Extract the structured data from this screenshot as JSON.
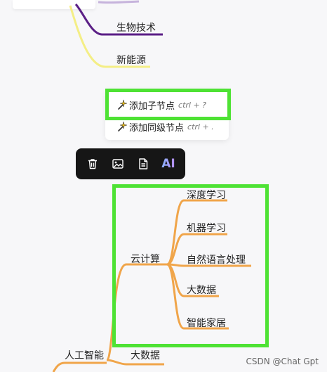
{
  "mindmap": {
    "upper_branch_nodes": [
      "生物技术",
      "新能源"
    ],
    "cloud_node": "云计算",
    "cloud_children": [
      "深度学习",
      "机器学习",
      "自然语言处理",
      "大数据",
      "智能家居"
    ],
    "root_node": "人工智能",
    "root_sibling": "大数据"
  },
  "context_menu": {
    "items": [
      {
        "label": "添加子节点",
        "shortcut": "ctrl + ?"
      },
      {
        "label": "添加同级节点",
        "shortcut": "ctrl + ."
      }
    ]
  },
  "node_toolbar": {
    "buttons": [
      "trash-icon",
      "image-icon",
      "document-icon",
      "ai-button"
    ],
    "ai_label": "AI"
  },
  "colors": {
    "purple_branch": "#5b1f86",
    "yellow_branch": "#f4ee86",
    "orange_branch": "#f0a54a",
    "highlight": "#4ee234",
    "toolbar_bg": "#161616"
  },
  "watermark": "CSDN @Chat Gpt"
}
